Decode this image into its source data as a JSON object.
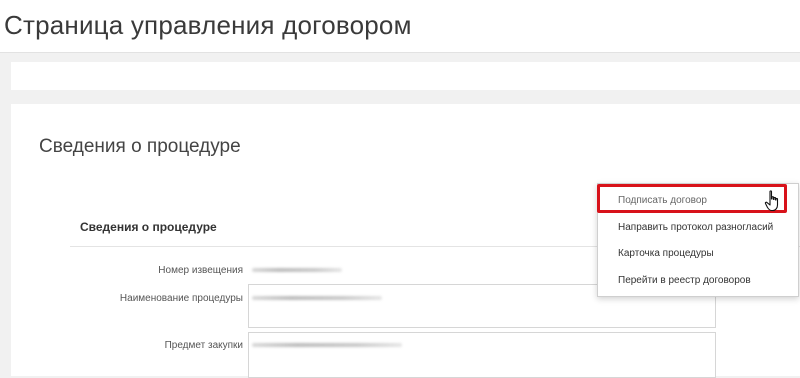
{
  "header": {
    "title": "Страница управления договором"
  },
  "procedure": {
    "section_title": "Сведения о процедуре",
    "info_title": "Сведения о процедуре",
    "fields": [
      {
        "label": "Номер извещения"
      },
      {
        "label": "Наименование процедуры"
      },
      {
        "label": "Предмет закупки"
      }
    ]
  },
  "menu": {
    "items": [
      {
        "label": "Подписать договор"
      },
      {
        "label": "Направить протокол разногласий"
      },
      {
        "label": "Карточка процедуры"
      },
      {
        "label": "Перейти в реестр договоров"
      }
    ],
    "highlight_color": "#d8121a"
  },
  "icons": {
    "cursor": "hand-pointer-icon"
  }
}
